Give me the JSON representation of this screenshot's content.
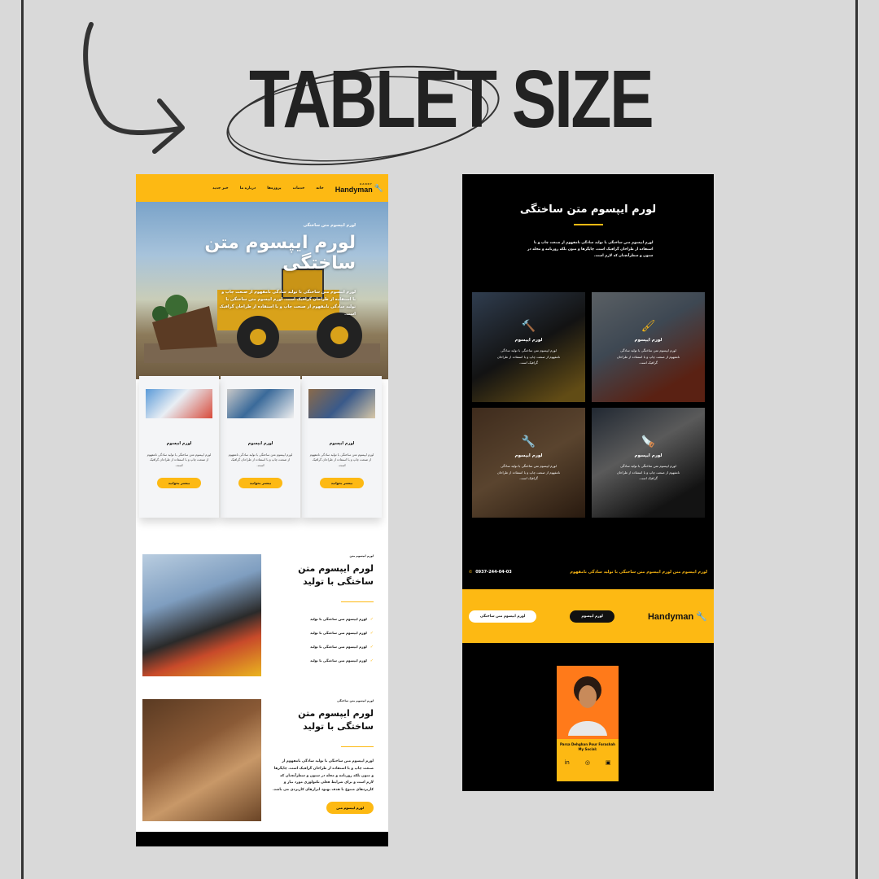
{
  "heading": "TABLET SIZE",
  "tablet": {
    "nav": {
      "logo_text": "Handyman",
      "logo_sub": "HANDY",
      "links": [
        "خانه",
        "خدمات",
        "پروژه‌ها",
        "درباره ما",
        "خبر جدید"
      ]
    },
    "hero": {
      "kicker": "لورم ایپسوم متن ساختگی",
      "title": "لورم ایپسوم متن ساختگی",
      "text": "لورم ایپسوم متن ساختگی با تولید سادگی نامفهوم از صنعت چاپ و با استفاده از طراحان گرافیک است. لورم ایپسوم متن ساختگی با تولید سادگی نامفهوم از صنعت چاپ و با استفاده از طراحان گرافیک است."
    },
    "cards": [
      {
        "title": "لورم ایپسوم",
        "text": "لورم ایپسوم متن ساختگی با تولید سادگی نامفهوم از صنعت چاپ و با استفاده از طراحان گرافیک است.",
        "button": "بیشتر بخوانید"
      },
      {
        "title": "لورم ایپسوم",
        "text": "لورم ایپسوم متن ساختگی با تولید سادگی نامفهوم از صنعت چاپ و با استفاده از طراحان گرافیک است.",
        "button": "بیشتر بخوانید"
      },
      {
        "title": "لورم ایپسوم",
        "text": "لورم ایپسوم متن ساختگی با تولید سادگی نامفهوم از صنعت چاپ و با استفاده از طراحان گرافیک است.",
        "button": "بیشتر بخوانید"
      }
    ],
    "section1": {
      "kicker": "لورم ایپسوم متن",
      "title": "لورم ایپسوم متن ساختگی با تولید",
      "items": [
        "لورم ایپسوم متن ساختگی با تولید",
        "لورم ایپسوم متن ساختگی با تولید",
        "لورم ایپسوم متن ساختگی با تولید",
        "لورم ایپسوم متن ساختگی با تولید"
      ]
    },
    "section2": {
      "kicker": "لورم ایپسوم متن ساختگی",
      "title": "لورم ایپسوم متن ساختگی با تولید",
      "text": "لورم ایپسوم متن ساختگی با تولید سادگی نامفهوم از صنعت چاپ و با استفاده از طراحان گرافیک است. چاپگرها و متون بلکه روزنامه و مجله در ستون و سطرآنچنان که لازم است و برای شرایط فعلی تکنولوژی مورد نیاز و کاربردهای متنوع با هدف بهبود ابزارهای کاربردی می باشد.",
      "button": "لورم ایپسوم متن"
    }
  },
  "dark": {
    "title": "لورم ایپسوم متن ساختگی",
    "text": "لورم ایپسوم متن ساختگی با تولید سادگی نامفهوم از صنعت چاپ و با استفاده از طراحان گرافیک است. چاپگرها و متون بلکه روزنامه و مجله در ستون و سطرآنچنان که لازم است.",
    "tiles": [
      {
        "icon": "paint-roller-icon",
        "glyph": "🖌",
        "title": "لورم ایپسوم",
        "text": "لورم ایپسوم متن ساختگی با تولید سادگی نامفهوم از صنعت چاپ و با استفاده از طراحان گرافیک است."
      },
      {
        "icon": "hammer-icon",
        "glyph": "🔨",
        "title": "لورم ایپسوم",
        "text": "لورم ایپسوم متن ساختگی با تولید سادگی نامفهوم از صنعت چاپ و با استفاده از طراحان گرافیک است."
      },
      {
        "icon": "saw-icon",
        "glyph": "🪚",
        "title": "لورم ایپسوم",
        "text": "لورم ایپسوم متن ساختگی با تولید سادگی نامفهوم از صنعت چاپ و با استفاده از طراحان گرافیک است."
      },
      {
        "icon": "wrench-icon",
        "glyph": "🔧",
        "title": "لورم ایپسوم",
        "text": "لورم ایپسوم متن ساختگی با تولید سادگی نامفهوم از صنعت چاپ و با استفاده از طراحان گرافیک است."
      }
    ],
    "contact_text": "لورم ایپسوم متن لورم ایپسوم متن ساختگی با تولید سادگی نامفهوم",
    "phone": "0937-244-04-03",
    "band": {
      "logo": "Handyman",
      "btn_dark": "لورم ایپسوم",
      "btn_light": "لورم ایپسوم متن ساختگی"
    },
    "profile": {
      "name": "Parsa Dehghan Pour Farashah",
      "social_label": "My Social:"
    }
  },
  "colors": {
    "accent": "#fdb913",
    "page_bg": "#d9d9d9",
    "dark_bg": "#000000",
    "profile_bg": "#ff7a1a"
  }
}
